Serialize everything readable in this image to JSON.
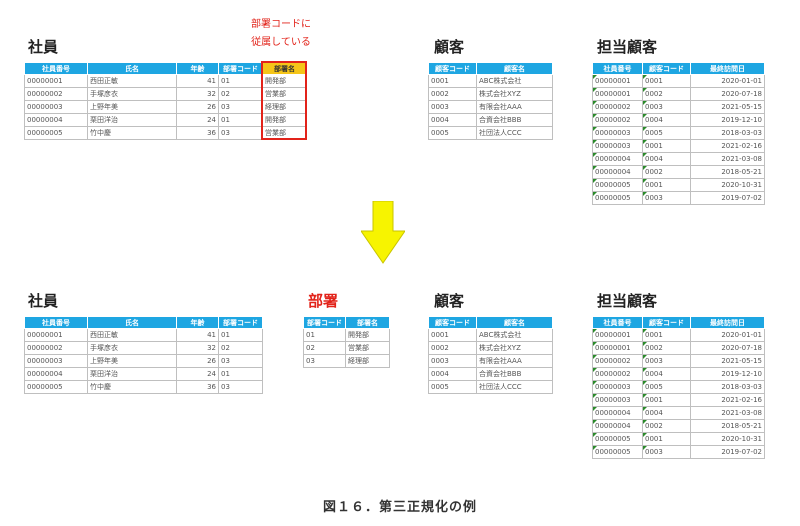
{
  "note": {
    "line1": "部署コードに",
    "line2": "従属している"
  },
  "before": {
    "employee": {
      "title": "社員",
      "headers": [
        "社員番号",
        "氏名",
        "年齢",
        "部署コード",
        "部署名"
      ],
      "rows": [
        [
          "00000001",
          "西田正敏",
          "41",
          "01",
          "開発部"
        ],
        [
          "00000002",
          "手塚彦衣",
          "32",
          "02",
          "営業部"
        ],
        [
          "00000003",
          "上野年美",
          "26",
          "03",
          "経理部"
        ],
        [
          "00000004",
          "栗田洋治",
          "24",
          "01",
          "開発部"
        ],
        [
          "00000005",
          "竹中慶",
          "36",
          "03",
          "営業部"
        ]
      ]
    },
    "customer": {
      "title": "顧客",
      "headers": [
        "顧客コード",
        "顧客名"
      ],
      "rows": [
        [
          "0001",
          "ABC株式会社"
        ],
        [
          "0002",
          "株式会社XYZ"
        ],
        [
          "0003",
          "有限会社AAA"
        ],
        [
          "0004",
          "合資会社BBB"
        ],
        [
          "0005",
          "社団法人CCC"
        ]
      ]
    },
    "charge": {
      "title": "担当顧客",
      "headers": [
        "社員番号",
        "顧客コード",
        "最終訪問日"
      ],
      "rows": [
        [
          "00000001",
          "0001",
          "2020-01-01"
        ],
        [
          "00000001",
          "0002",
          "2020-07-18"
        ],
        [
          "00000002",
          "0003",
          "2021-05-15"
        ],
        [
          "00000002",
          "0004",
          "2019-12-10"
        ],
        [
          "00000003",
          "0005",
          "2018-03-03"
        ],
        [
          "00000003",
          "0001",
          "2021-02-16"
        ],
        [
          "00000004",
          "0004",
          "2021-03-08"
        ],
        [
          "00000004",
          "0002",
          "2018-05-21"
        ],
        [
          "00000005",
          "0001",
          "2020-10-31"
        ],
        [
          "00000005",
          "0003",
          "2019-07-02"
        ]
      ]
    }
  },
  "after": {
    "employee": {
      "title": "社員",
      "headers": [
        "社員番号",
        "氏名",
        "年齢",
        "部署コード"
      ],
      "rows": [
        [
          "00000001",
          "西田正敏",
          "41",
          "01"
        ],
        [
          "00000002",
          "手塚彦衣",
          "32",
          "02"
        ],
        [
          "00000003",
          "上野年美",
          "26",
          "03"
        ],
        [
          "00000004",
          "栗田洋治",
          "24",
          "01"
        ],
        [
          "00000005",
          "竹中慶",
          "36",
          "03"
        ]
      ]
    },
    "department": {
      "title": "部署",
      "headers": [
        "部署コード",
        "部署名"
      ],
      "rows": [
        [
          "01",
          "開発部"
        ],
        [
          "02",
          "営業部"
        ],
        [
          "03",
          "経理部"
        ]
      ]
    },
    "customer": {
      "title": "顧客",
      "headers": [
        "顧客コード",
        "顧客名"
      ],
      "rows": [
        [
          "0001",
          "ABC株式会社"
        ],
        [
          "0002",
          "株式会社XYZ"
        ],
        [
          "0003",
          "有限会社AAA"
        ],
        [
          "0004",
          "合資会社BBB"
        ],
        [
          "0005",
          "社団法人CCC"
        ]
      ]
    },
    "charge": {
      "title": "担当顧客",
      "headers": [
        "社員番号",
        "顧客コード",
        "最終訪問日"
      ],
      "rows": [
        [
          "00000001",
          "0001",
          "2020-01-01"
        ],
        [
          "00000001",
          "0002",
          "2020-07-18"
        ],
        [
          "00000002",
          "0003",
          "2021-05-15"
        ],
        [
          "00000002",
          "0004",
          "2019-12-10"
        ],
        [
          "00000003",
          "0005",
          "2018-03-03"
        ],
        [
          "00000003",
          "0001",
          "2021-02-16"
        ],
        [
          "00000004",
          "0004",
          "2021-03-08"
        ],
        [
          "00000004",
          "0002",
          "2018-05-21"
        ],
        [
          "00000005",
          "0001",
          "2020-10-31"
        ],
        [
          "00000005",
          "0003",
          "2019-07-02"
        ]
      ]
    }
  },
  "caption": "図１６．第三正規化の例"
}
